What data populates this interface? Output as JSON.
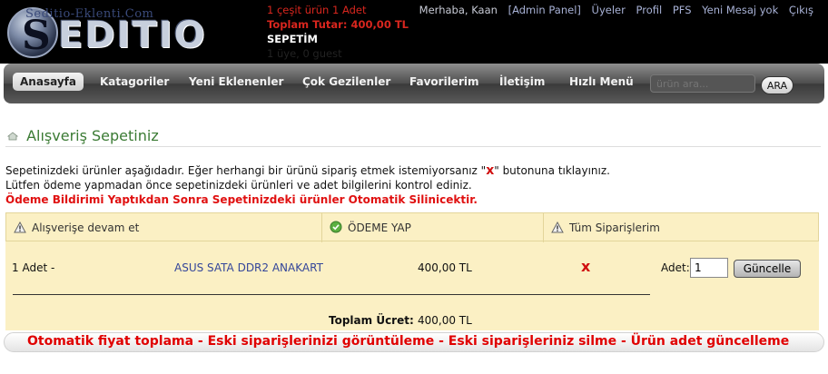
{
  "header": {
    "logo_url_text": "Seditio-Eklenti.Com",
    "logo_text": "EDITIO",
    "logo_letter": "S",
    "cart": {
      "line1": "1 çeşit ürün 1 Adet",
      "line2": "Toplam Tutar: 400,00 TL",
      "line3": "SEPETİM",
      "line4": "1 üye, 0 guest"
    },
    "user_links": {
      "greeting": "Merhaba, Kaan",
      "admin": "[Admin Panel]",
      "members": "Üyeler",
      "profile": "Profil",
      "pfs": "PFS",
      "messages": "Yeni Mesaj yok",
      "logout": "Çıkış"
    }
  },
  "nav": {
    "home": "Anasayfa",
    "items": [
      "Katagoriler",
      "Yeni Eklenenler",
      "Çok Gezilenler",
      "Favorilerim",
      "İletişim",
      "Hızlı Menü"
    ],
    "search_placeholder": "ürün ara...",
    "search_button": "ARA"
  },
  "main": {
    "title": "Alışveriş Sepetiniz",
    "intro_line1_a": "Sepetinizdeki ürünler aşağıdadır. Eğer herhangi bir ürünü sipariş etmek istemiyorsanız \"",
    "intro_line1_x": "x",
    "intro_line1_b": "\" butonuna tıklayınız.",
    "intro_line2": "Lütfen ödeme yapmadan önce sepetinizdeki ürünleri ve adet bilgilerini kontrol ediniz.",
    "intro_warning": "Ödeme Bildirimi Yaptıkdan Sonra Sepetinizdeki ürünler Otomatik Silinicektir.",
    "tabs": {
      "continue": "Alışverişe devam et",
      "pay": "ÖDEME YAP",
      "orders": "Tüm Siparişlerim"
    },
    "cart_row": {
      "qty": "1 Adet -",
      "product": "ASUS SATA DDR2 ANAKART",
      "price": "400,00 TL",
      "remove": "x",
      "adet_label": "Adet:",
      "adet_value": "1",
      "update_button": "Güncelle"
    },
    "total_label": "Toplam Ücret:",
    "total_value": "400,00 TL"
  },
  "footer": {
    "text": "Otomatik fiyat toplama  - Eski siparişlerinizi görüntüleme - Eski siparişleriniz silme - Ürün adet güncelleme"
  },
  "colors": {
    "brand_green": "#3b7b34",
    "warning_red": "#e01010",
    "panel_bg": "#fbf0c4",
    "link_blue": "#34469a"
  }
}
